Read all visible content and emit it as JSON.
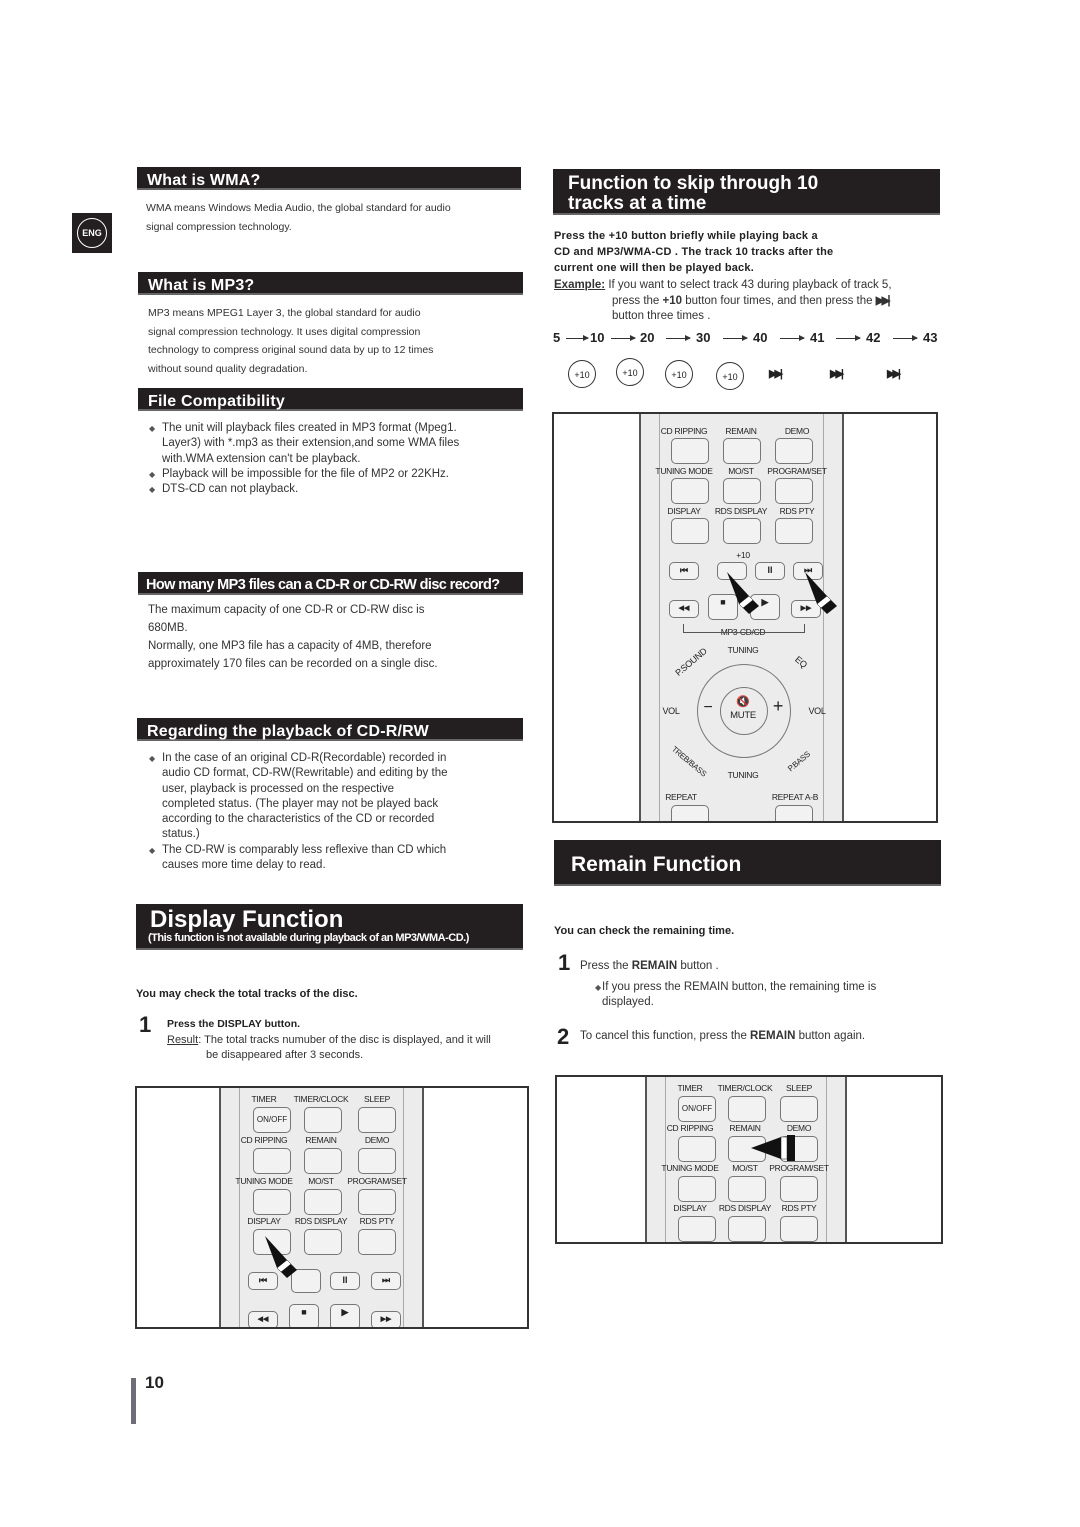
{
  "page": {
    "lang_badge": "ENG",
    "page_number": "10"
  },
  "left": {
    "wma": {
      "title": "What is WMA?",
      "lines": [
        "WMA means Windows Media Audio, the global standard for audio",
        "signal compression technology."
      ]
    },
    "mp3": {
      "title": "What is MP3?",
      "lines": [
        "MP3 means MPEG1 Layer 3, the global standard for audio",
        "signal compression technology. It uses digital compression",
        "technology to compress original sound data by up to 12 times",
        "without sound quality degradation."
      ]
    },
    "compat": {
      "title": "File Compatibility",
      "bullets": [
        [
          "The unit will playback files created in MP3 format (Mpeg1.",
          "Layer3) with *.mp3 as their extension,and some WMA files",
          "with.WMA extension can't be playback."
        ],
        [
          "Playback will be impossible for the file of MP2 or 22KHz."
        ],
        [
          "DTS-CD can not playback."
        ]
      ]
    },
    "howmany": {
      "title": "How many MP3 files can a CD-R or CD-RW disc record?",
      "lines": [
        "The maximum capacity of one CD-R or CD-RW disc is",
        "680MB.",
        "Normally, one MP3 file has a capacity of 4MB, therefore",
        "approximately 170 files can be recorded on a single disc."
      ]
    },
    "cdrw": {
      "title": "Regarding the playback of CD-R/RW",
      "bullets": [
        [
          "In the case of an original CD-R(Recordable) recorded in",
          "audio CD format, CD-RW(Rewritable) and editing by the",
          "user, playback is processed on the respective",
          "completed status. (The player may not be played back",
          "according to the characteristics of the CD or recorded",
          "status.)"
        ],
        [
          "The CD-RW is comparably less reflexive than CD which",
          "causes more time delay to read."
        ]
      ]
    },
    "display": {
      "title": "Display Function",
      "subtitle": "(This function is not available during playback of an MP3/WMA-CD.)",
      "intro": "You may check the total tracks of the disc.",
      "step_num": "1",
      "step_title": "Press the DISPLAY button.",
      "result_label": "Result",
      "result_lines": [
        ": The total tracks numuber of the disc is displayed, and it will",
        "be disappeared after 3 seconds."
      ]
    }
  },
  "right": {
    "skip": {
      "title_lines": [
        "Function to skip through 10",
        "tracks at a time"
      ],
      "intro_lines": [
        "Press the +10 button briefly while playing back a",
        "CD and MP3/WMA-CD . The track 10 tracks after the",
        "current one will then be played back."
      ],
      "example_label": "Example:",
      "example_lines": [
        "If you want to select track 43 during playback of track 5,",
        "press the ",
        "+10",
        " button four times, and then press the",
        "button three times ."
      ],
      "sequence": [
        "5",
        "10",
        "20",
        "30",
        "40",
        "41",
        "42",
        "43"
      ],
      "button_row": [
        "+10",
        "+10",
        "+10",
        "+10",
        "skip-next",
        "skip-next",
        "skip-next"
      ]
    },
    "remain": {
      "title": "Remain Function",
      "intro": "You can check the remaining time.",
      "step1_num": "1",
      "step1_pre": "Press the ",
      "step1_bold": "REMAIN",
      "step1_post": " button .",
      "step1_note": [
        "If you press the REMAIN button, the remaining time is",
        "displayed."
      ],
      "step2_num": "2",
      "step2_pre": "To cancel this function, press the ",
      "step2_bold": "REMAIN",
      "step2_post": " button again."
    }
  },
  "remote": {
    "row_timer": [
      "TIMER",
      "TIMER/CLOCK",
      "SLEEP"
    ],
    "onoff": "ON/OFF",
    "row_cd": [
      "CD RIPPING",
      "REMAIN",
      "DEMO"
    ],
    "row_tuning": [
      "TUNING MODE",
      "MO/ST",
      "PROGRAM/SET"
    ],
    "row_display": [
      "DISPLAY",
      "RDS DISPLAY",
      "RDS PTY"
    ],
    "plus10": "+10",
    "transport1": [
      "⏮",
      "",
      "II",
      "⏭"
    ],
    "transport2": [
      "◀◀",
      "■",
      "▶",
      "▶▶"
    ],
    "mp3cd": "MP3-CD/CD",
    "psound": "P.SOUND",
    "eq": "EQ",
    "tuning": "TUNING",
    "vol": "VOL",
    "mute": "MUTE",
    "trebbass": "TREB/BASS",
    "pbass": "P.BASS",
    "repeat": "REPEAT",
    "repeat_ab": "REPEAT A-B"
  }
}
